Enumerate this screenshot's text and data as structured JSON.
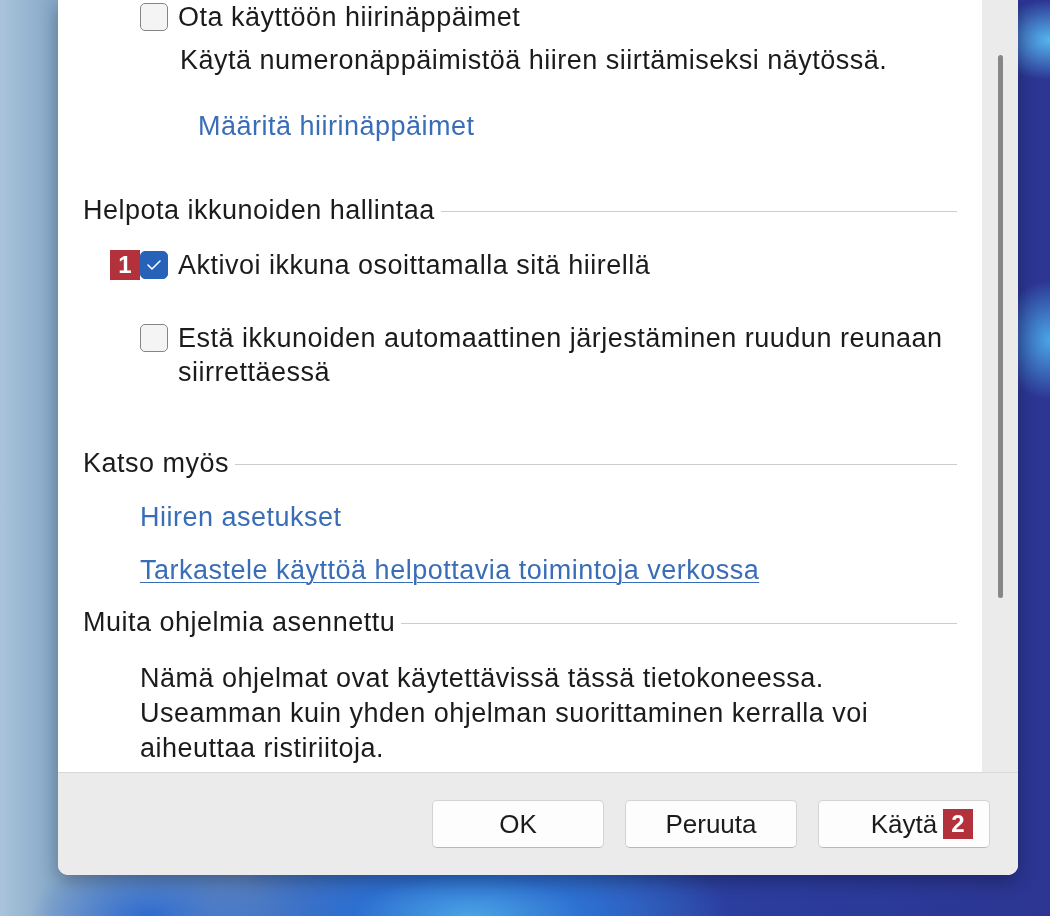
{
  "mouse_keys": {
    "checkbox": {
      "label": "Ota käyttöön hiirinäppäimet",
      "checked": false
    },
    "description": "Käytä numeronäppäimistöä hiiren siirtämiseksi näytössä.",
    "link": {
      "label": "Määritä hiirinäppäimet",
      "hovered": false
    }
  },
  "sections": [
    {
      "heading": "Helpota ikkunoiden hallintaa",
      "items": [
        {
          "kind": "checkbox",
          "label": "Aktivoi ikkuna osoittamalla sitä hiirellä",
          "checked": true,
          "badge": "1"
        },
        {
          "kind": "checkbox",
          "label": "Estä ikkunoiden automaattinen järjestäminen ruudun reunaan siirrettäessä",
          "checked": false
        }
      ]
    },
    {
      "heading": "Katso myös",
      "items": [
        {
          "kind": "link",
          "label": "Hiiren asetukset",
          "hovered": false
        },
        {
          "kind": "link",
          "label": "Tarkastele käyttöä helpottavia toimintoja verkossa",
          "hovered": true
        }
      ]
    },
    {
      "heading": "Muita ohjelmia asennettu",
      "items": [
        {
          "kind": "paragraph",
          "text": "Nämä ohjelmat ovat käytettävissä tässä tietokoneessa. Useamman kuin yhden ohjelman suorittaminen kerralla voi aiheuttaa ristiriitoja."
        }
      ]
    }
  ],
  "buttons": [
    {
      "label": "OK"
    },
    {
      "label": "Peruuta"
    },
    {
      "label": "Käytä",
      "badge": "2"
    }
  ]
}
